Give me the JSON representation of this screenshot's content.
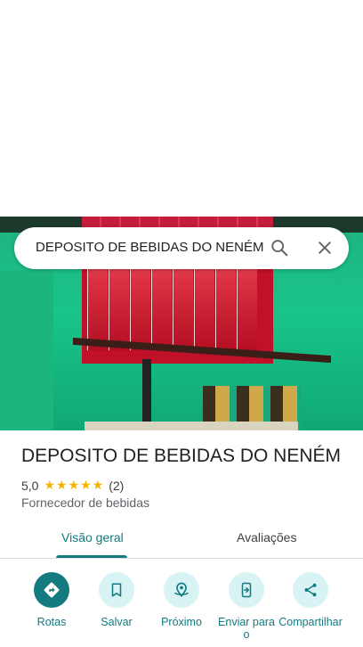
{
  "search": {
    "query": "DEPOSITO DE BEBIDAS DO NENÉM"
  },
  "place": {
    "name": "DEPOSITO DE BEBIDAS DO NENÉM",
    "rating": "5,0",
    "stars": "★★★★★",
    "review_count": "(2)",
    "category": "Fornecedor de bebidas"
  },
  "tabs": [
    {
      "label": "Visão geral",
      "active": true
    },
    {
      "label": "Avaliações",
      "active": false
    }
  ],
  "actions": [
    {
      "label": "Rotas",
      "icon": "directions-icon"
    },
    {
      "label": "Salvar",
      "icon": "bookmark-icon"
    },
    {
      "label": "Próximo",
      "icon": "nearby-icon"
    },
    {
      "label": "Enviar para o",
      "icon": "send-to-phone-icon"
    },
    {
      "label": "Compartilhar",
      "icon": "share-icon"
    }
  ],
  "colors": {
    "accent": "#137a7f",
    "accent_light": "#d8f3f4",
    "star": "#f4b400"
  }
}
